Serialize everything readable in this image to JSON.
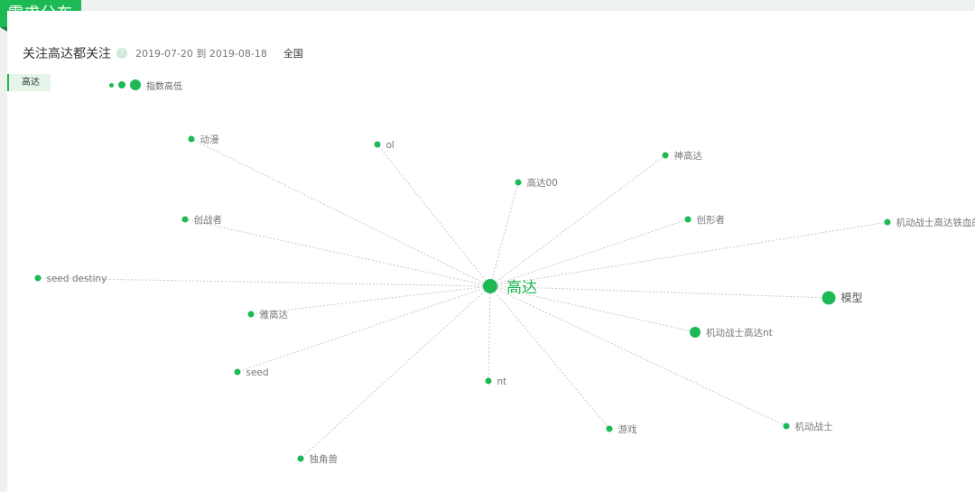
{
  "section_title": "需求分布",
  "header": {
    "keyword": "关注高达都关注",
    "help_glyph": "?",
    "date_range": "2019-07-20 到 2019-08-18",
    "region": "全国"
  },
  "side_tab": "高达",
  "legend": {
    "label": "指数高低"
  },
  "colors": {
    "accent": "#1db954",
    "edge": "#c8c8c8"
  },
  "graph": {
    "center": {
      "label": "高达"
    },
    "nodes": [
      {
        "label": "动漫",
        "level": "small"
      },
      {
        "label": "ol",
        "level": "small"
      },
      {
        "label": "神高达",
        "level": "small"
      },
      {
        "label": "高达00",
        "level": "small"
      },
      {
        "label": "创战者",
        "level": "small"
      },
      {
        "label": "创形者",
        "level": "small"
      },
      {
        "label": "机动战士高达铁血的奥尔芬斯",
        "level": "small"
      },
      {
        "label": "seed destiny",
        "level": "small"
      },
      {
        "label": "模型",
        "level": "large"
      },
      {
        "label": "雅高达",
        "level": "small"
      },
      {
        "label": "机动战士高达nt",
        "level": "medium"
      },
      {
        "label": "seed",
        "level": "small"
      },
      {
        "label": "nt",
        "level": "small"
      },
      {
        "label": "游戏",
        "level": "small"
      },
      {
        "label": "机动战士",
        "level": "small"
      },
      {
        "label": "独角兽",
        "level": "small"
      }
    ]
  }
}
